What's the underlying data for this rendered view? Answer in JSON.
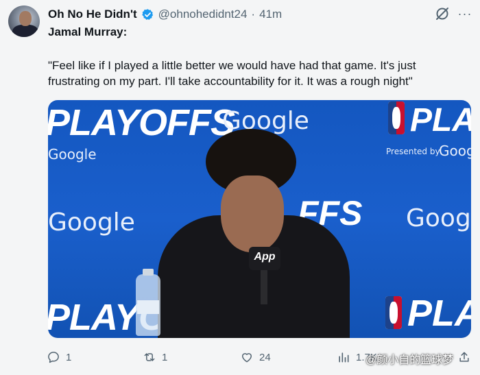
{
  "tweet": {
    "display_name": "Oh No He Didn't",
    "handle": "@ohnohedidnt24",
    "separator": "·",
    "time": "41m",
    "lead": "Jamal Murray:",
    "quote": "\"Feel like if I played a little better we would have had that game. It's just frustrating on my part. I'll take accountability for it. It was a rough night\""
  },
  "media": {
    "backdrop": {
      "playoffs_left": "PLAYOFFS",
      "google_left_top": "Google",
      "google_center_top": "Google",
      "playoffs_right_top": "PLAYO",
      "presented_by": "Presented by",
      "google_right_top": "Google",
      "google_left_mid": "Google",
      "playoffs_center_mid": "FFS",
      "google_right_mid": "Goog",
      "playoffs_left_bottom": "PLAYOFF",
      "playoffs_right_bottom": "PLAYO"
    },
    "mic_flag": "App",
    "logo_text": "NBA"
  },
  "actions": {
    "replies": "1",
    "reposts": "1",
    "likes": "24",
    "views": "1.7K"
  },
  "watermark": "@颜小自的篮球梦",
  "colors": {
    "verified": "#1d9bf0",
    "backdrop_blue": "#1a5fcc",
    "secondary_text": "#536471"
  },
  "icons": [
    "verified-badge-icon",
    "grok-icon",
    "more-icon",
    "reply-icon",
    "repost-icon",
    "like-icon",
    "views-icon",
    "share-icon"
  ]
}
